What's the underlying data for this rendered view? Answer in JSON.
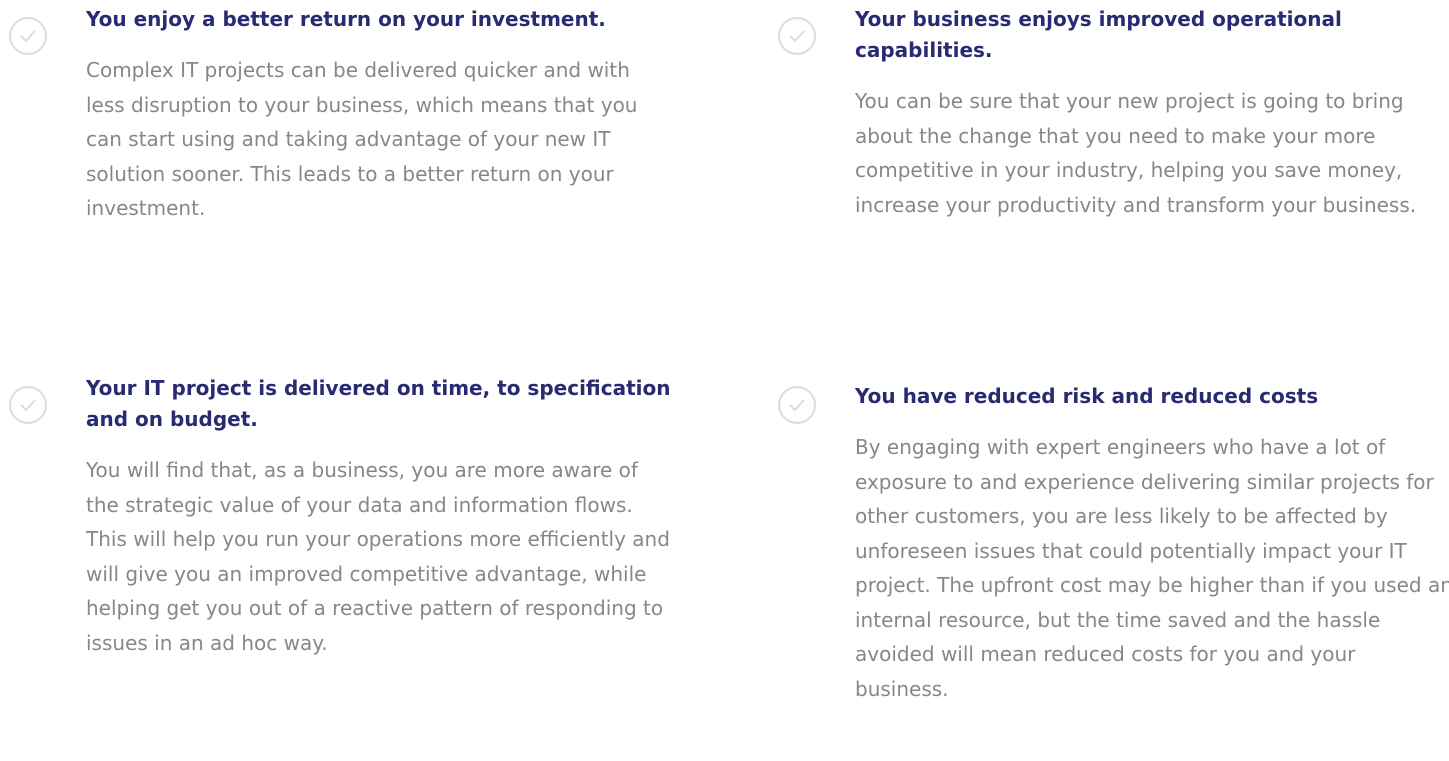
{
  "benefits": [
    {
      "icon": "check-circle-icon",
      "title": "You enjoy a better return on your investment.",
      "body": "Complex IT projects can be delivered quicker and with less disruption to your business, which means that you can start using and taking advantage of your new IT solution sooner. This leads to a better return on your investment."
    },
    {
      "icon": "check-circle-icon",
      "title": "Your business enjoys improved operational capabilities.",
      "body": "You can be sure that your new project is going to bring about the change that you need to make your more competitive in your industry, helping you save money, increase your productivity and transform your business."
    },
    {
      "icon": "check-circle-icon",
      "title": "Your IT project is delivered on time, to specification and on budget.",
      "body": "You will find that, as a business, you are more aware of the strategic value of your data and information flows. This will help you run your operations more efficiently and will give you an improved competitive advantage, while helping get you out of a reactive pattern of responding to issues in an ad hoc way."
    },
    {
      "icon": "check-circle-icon",
      "title": "You have reduced risk and reduced costs",
      "body": "By engaging with expert engineers who have a lot of exposure to and experience delivering similar projects for other customers, you are less likely to be affected by unforeseen issues that could potentially impact your IT project. The upfront cost may be higher than if you used an internal resource, but the time saved and the hassle avoided will mean reduced costs for you and your business."
    }
  ],
  "colors": {
    "heading": "#282a72",
    "body": "#878787",
    "icon": "#dcdcdc"
  }
}
